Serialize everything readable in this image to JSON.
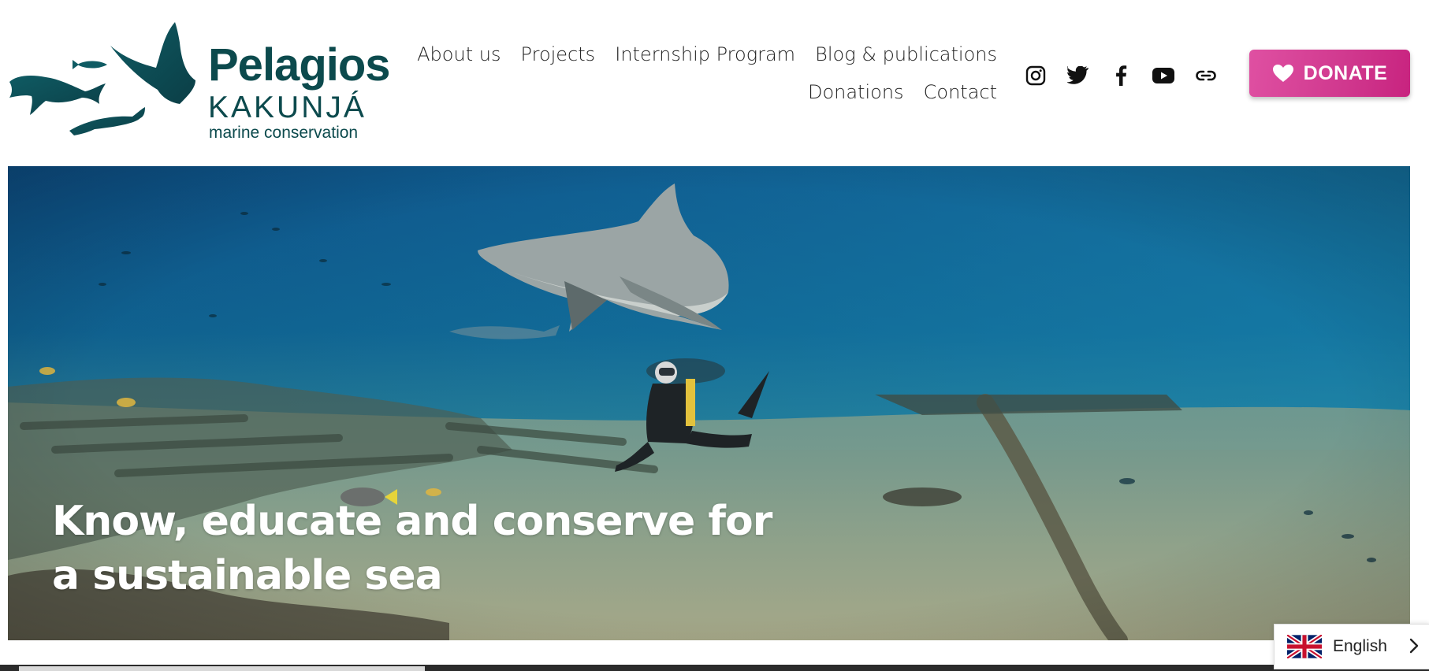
{
  "brand": {
    "name": "Pelagios",
    "name_line2": "KAKUNJÁ",
    "tagline": "marine conservation",
    "color": "#0c4a4d"
  },
  "nav": {
    "items": [
      {
        "label": "About us"
      },
      {
        "label": "Projects"
      },
      {
        "label": "Internship Program"
      },
      {
        "label": "Blog & publications"
      },
      {
        "label": "Donations"
      },
      {
        "label": "Contact"
      }
    ]
  },
  "social": {
    "icons": [
      "instagram-icon",
      "twitter-icon",
      "facebook-icon",
      "youtube-icon",
      "link-icon"
    ]
  },
  "donate": {
    "label": "DONATE",
    "icon": "heart-icon",
    "color": "#d0388e"
  },
  "hero": {
    "heading": "Know, educate and conserve for a sustainable sea"
  },
  "language": {
    "label": "English",
    "flag": "uk-flag-icon"
  }
}
